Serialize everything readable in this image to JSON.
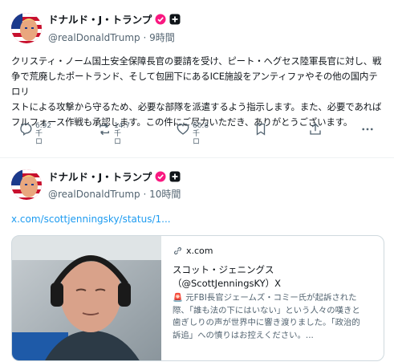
{
  "posts": [
    {
      "author": {
        "display_name": "ドナルド・J・トランプ",
        "handle": "@realDonaldTrump",
        "separator": "·",
        "time": "9時間"
      },
      "text_lines": [
        "クリスティ・ノーム国土安全保障長官の要請を受け、ピート・ヘグセス陸軍長官に対し、戦",
        "争で荒廃したポートランド、そして包囲下にあるICE施設をアンティファやその他の国内テロリ",
        "ストによる攻撃から守るため、必要な部隊を派遣するよう指示します。また、必要であれば",
        "フルフォース作戦も承認します。この件にご尽力いただき、ありがとうございます。"
      ],
      "actions": {
        "reply": {
          "icon": "reply-icon",
          "count": "6.92千",
          "unit": "ロ"
        },
        "repost": {
          "icon": "repost-icon",
          "count": "14.7千",
          "unit": "ロ"
        },
        "like": {
          "icon": "heart-icon",
          "count": "60.8千",
          "unit": "ロ"
        },
        "bookmark": {
          "icon": "bookmark-icon"
        },
        "share": {
          "icon": "share-icon"
        },
        "more": {
          "icon": "more-icon"
        }
      }
    },
    {
      "author": {
        "display_name": "ドナルド・J・トランプ",
        "handle": "@realDonaldTrump",
        "separator": "·",
        "time": "10時間"
      },
      "link_text": "x.com/scottjenningsky/status/1...",
      "card": {
        "domain": "x.com",
        "title_line1": "スコット・ジェニングス",
        "title_line2": "（@ScottJenningsKY）X",
        "desc_lines": [
          "🚨 元FBI長官ジェームズ・コミー氏が起訴された",
          "際、「誰も法の下にはいない」という人々の嘆きと",
          "歯ぎしりの声が世界中に響き渡りました。「政治的",
          "訴追」への憤りはお控えください。..."
        ]
      }
    }
  ],
  "colors": {
    "accent": "#1d9bf0",
    "text": "#0f1419",
    "muted": "#536471",
    "verified": "#f91880",
    "border": "#cfd9de"
  }
}
